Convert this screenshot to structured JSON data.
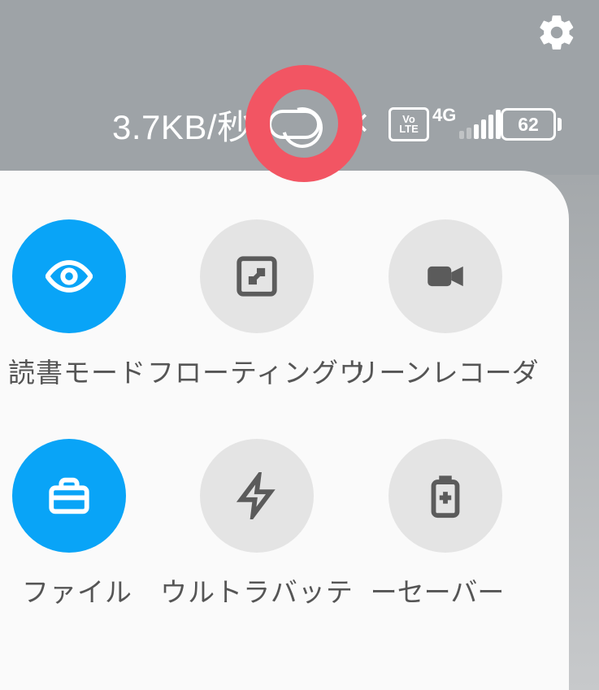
{
  "status": {
    "net_speed": "3.7KB/秒",
    "volte_top": "Vo",
    "volte_bottom": "LTE",
    "net_gen": "4G",
    "battery_pct": "62"
  },
  "tiles": {
    "reading": {
      "label": "読書モード",
      "active": true
    },
    "floating": {
      "label": "フローティングウ",
      "active": false
    },
    "recorder": {
      "label": "リーンレコーダ",
      "active": false
    },
    "file": {
      "label": "ファイル",
      "active": true
    },
    "ultrabatt": {
      "label": "ウルトラバッテ",
      "active": false
    },
    "saver": {
      "label": "ーセーバー",
      "active": false
    }
  }
}
